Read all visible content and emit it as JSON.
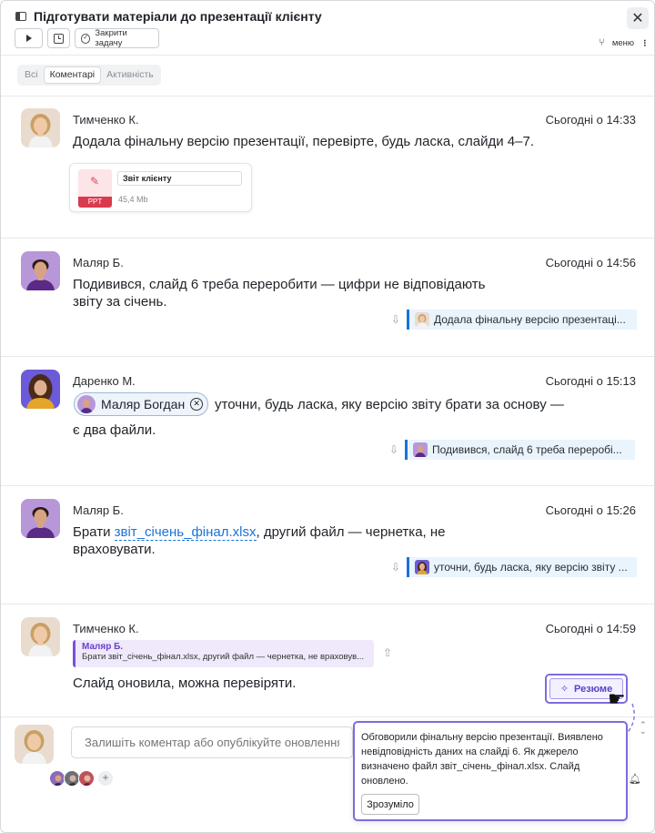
{
  "header": {
    "title": "Підготувати матеріали до презентації клієнту",
    "close_task_label": "Закрити задачу",
    "menu_label": "меню"
  },
  "tabs": [
    {
      "label": "Всі"
    },
    {
      "label": "Коментарі"
    },
    {
      "label": "Активність"
    }
  ],
  "comments": [
    {
      "author": "Тимченко К.",
      "time": "Сьогодні о 14:33",
      "text": "Додала фінальну версію презентації, перевірте, будь ласка, слайди 4–7.",
      "attachment": {
        "type_label": "PPT",
        "name": "Звіт клієнту",
        "size": "45,4 Mb"
      }
    },
    {
      "author": "Маляр Б.",
      "time": "Сьогодні о 14:56",
      "text_line1": "Подивився, слайд 6 треба переробити — цифри не відповідають",
      "text_line2": "звіту за січень.",
      "reply_to": "Додала фінальну версію презентаці..."
    },
    {
      "author": "Даренко М.",
      "time": "Сьогодні о 15:13",
      "mention": "Маляр Богдан",
      "text_line1": "уточни, будь ласка, яку версію звіту брати за основу —",
      "text_line2": "є два файли.",
      "reply_to": "Подивився, слайд 6 треба переробі..."
    },
    {
      "author": "Маляр Б.",
      "time": "Сьогодні о 15:26",
      "text_pre": "Брати ",
      "link": "звіт_січень_фінал.xlsx",
      "text_post": ", другий файл — чернетка, не",
      "text_line2": "враховувати.",
      "reply_to": "уточни, будь ласка, яку версію звіту ..."
    },
    {
      "author": "Тимченко К.",
      "time": "Сьогодні о 14:59",
      "quote_author": "Маляр Б.",
      "quote_text": "Брати звіт_січень_фінал.xlsx, другий файл — чернетка, не враховув...",
      "text": "Слайд оновила, можна перевіряти."
    }
  ],
  "summary_button_label": "Резюме",
  "composer": {
    "placeholder": "Залишіть коментар або опублікуйте оновлення"
  },
  "popover": {
    "text": "Обговорили фінальну версію презентації. Виявлено невідповідність даних на слайді 6. Як джерело визначено файл звіт_січень_фінал.xlsx. Слайд оновлено.",
    "button_label": "Зрозуміло"
  },
  "colors": {
    "accent": "#7f6ae0",
    "reply_bar": "#1a73d8",
    "quote_bar": "#7b4fd8",
    "ppt_red": "#d93a4d"
  }
}
